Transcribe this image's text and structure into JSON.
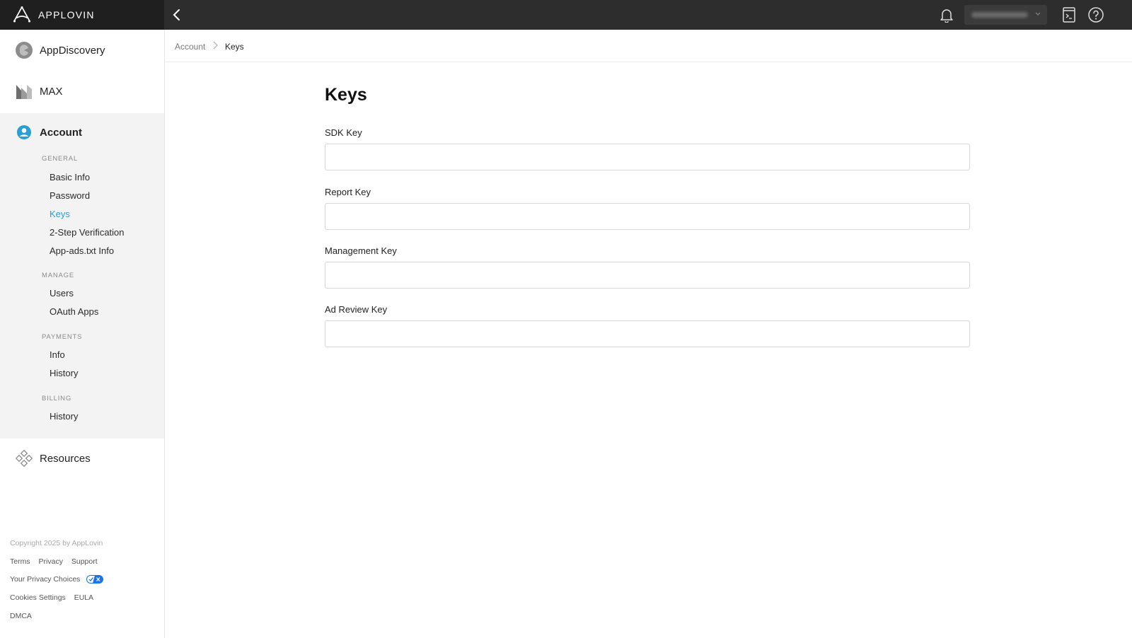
{
  "brand": {
    "name": "APPLOVIN"
  },
  "header": {
    "user_name": ""
  },
  "sidebar": {
    "top_items": [
      {
        "label": "AppDiscovery"
      },
      {
        "label": "MAX"
      }
    ],
    "account": {
      "label": "Account",
      "sections": {
        "general": {
          "title": "GENERAL",
          "items": [
            "Basic Info",
            "Password",
            "Keys",
            "2-Step Verification",
            "App-ads.txt Info"
          ]
        },
        "manage": {
          "title": "MANAGE",
          "items": [
            "Users",
            "OAuth Apps"
          ]
        },
        "payments": {
          "title": "PAYMENTS",
          "items": [
            "Info",
            "History"
          ]
        },
        "billing": {
          "title": "BILLING",
          "items": [
            "History"
          ]
        }
      },
      "active_item": "Keys"
    },
    "resources": {
      "label": "Resources"
    },
    "footer": {
      "copyright": "Copyright 2025 by AppLovin",
      "links_row1": [
        "Terms",
        "Privacy",
        "Support"
      ],
      "privacy_choices": "Your Privacy Choices",
      "links_row3": [
        "Cookies Settings",
        "EULA"
      ],
      "links_row4": [
        "DMCA"
      ]
    }
  },
  "breadcrumb": {
    "parent": "Account",
    "current": "Keys"
  },
  "main": {
    "title": "Keys",
    "fields": [
      {
        "label": "SDK Key",
        "value": ""
      },
      {
        "label": "Report Key",
        "value": ""
      },
      {
        "label": "Management Key",
        "value": ""
      },
      {
        "label": "Ad Review Key",
        "value": ""
      }
    ]
  },
  "colors": {
    "topbar": "#2d2d2d",
    "brand_bg": "#1f1f1f",
    "accent": "#2a9fd6",
    "privacy_badge": "#1a73e8"
  }
}
